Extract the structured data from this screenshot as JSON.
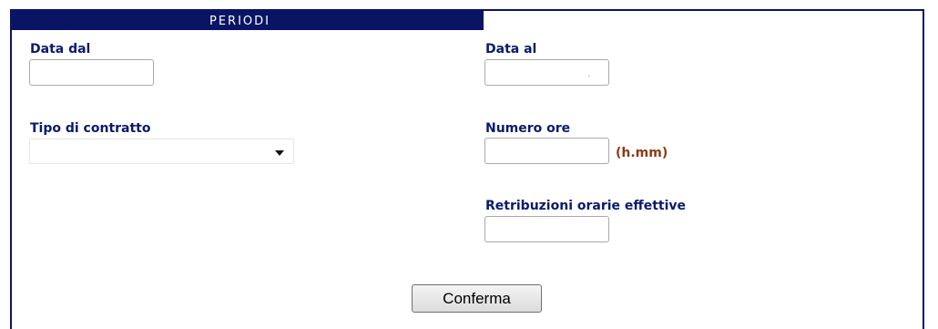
{
  "section": {
    "title": "PERIODI"
  },
  "form": {
    "data_dal": {
      "label": "Data dal",
      "value": ""
    },
    "data_al": {
      "label": "Data al",
      "value": ""
    },
    "tipo_contratto": {
      "label": "Tipo di contratto",
      "selected": ""
    },
    "numero_ore": {
      "label": "Numero ore",
      "value": "",
      "unit": "(h.mm)"
    },
    "retribuzioni": {
      "label": "Retribuzioni orarie effettive",
      "value": ""
    },
    "confirm_label": "Conferma"
  },
  "colors": {
    "header_bg": "#0a1464",
    "label": "#0a1a6e",
    "unit": "#8b3a16"
  }
}
